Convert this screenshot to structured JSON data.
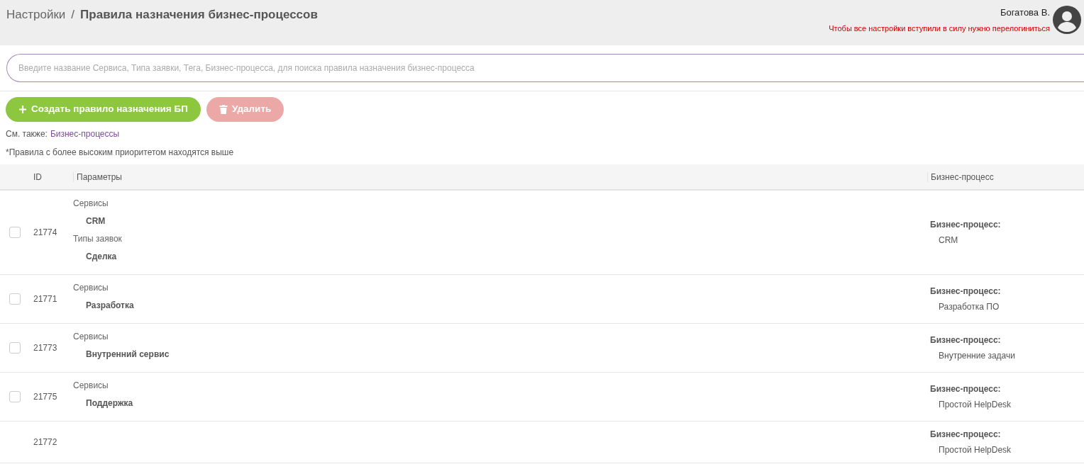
{
  "header": {
    "breadcrumb": "Настройки",
    "separator": "/",
    "title": "Правила назначения бизнес-процессов",
    "user": "Богатова В.",
    "notice": "Чтобы все настройки вступили в силу нужно перелогиниться"
  },
  "search": {
    "placeholder": "Введите название Сервиса, Типа заявки, Тега, Бизнес-процесса, для поиска правила назначения бизнес-процесса"
  },
  "buttons": [
    {
      "kind": "create",
      "label": "Создать правило назначения БП",
      "disabled": false
    },
    {
      "kind": "delete",
      "label": "Удалить",
      "disabled": true
    }
  ],
  "see_also": {
    "label": "См. также:",
    "link": "Бизнес-процессы"
  },
  "note": "*Правила с более высоким приоритетом находятся выше",
  "table": {
    "columns": [
      "ID",
      "Параметры",
      "Бизнес-процесс"
    ],
    "rows": [
      {
        "checked": false,
        "id": "21774",
        "params": [
          {
            "label": "Сервисы",
            "values": [
              "CRM"
            ]
          },
          {
            "label": "Типы заявок",
            "values": [
              "Сделка"
            ]
          }
        ],
        "bp": {
          "label": "Бизнес-процесс:",
          "value": "CRM"
        }
      },
      {
        "checked": false,
        "id": "21771",
        "params": [
          {
            "label": "Сервисы",
            "values": [
              "Разработка"
            ]
          }
        ],
        "bp": {
          "label": "Бизнес-процесс:",
          "value": "Разработка ПО"
        }
      },
      {
        "checked": false,
        "id": "21773",
        "params": [
          {
            "label": "Сервисы",
            "values": [
              "Внутренний сервис"
            ]
          }
        ],
        "bp": {
          "label": "Бизнес-процесс:",
          "value": "Внутренние задачи"
        }
      },
      {
        "checked": false,
        "id": "21775",
        "params": [
          {
            "label": "Сервисы",
            "values": [
              "Поддержка"
            ]
          }
        ],
        "bp": {
          "label": "Бизнес-процесс:",
          "value": "Простой HelpDesk"
        }
      },
      {
        "id": "21772",
        "params": [],
        "bp": {
          "label": "Бизнес-процесс:",
          "value": "Простой HelpDesk"
        }
      }
    ]
  }
}
